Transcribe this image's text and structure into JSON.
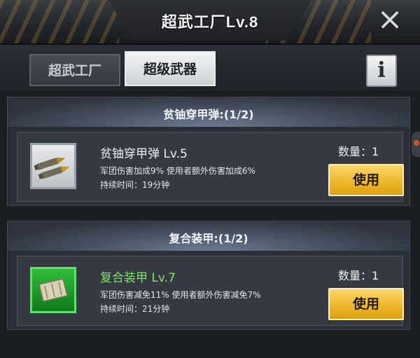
{
  "header": {
    "title": "超武工厂Lv.8",
    "close_icon": "×"
  },
  "tabs": [
    {
      "label": "超武工厂",
      "active": false
    },
    {
      "label": "超级武器",
      "active": true
    }
  ],
  "info_label": "i",
  "sections": [
    {
      "title": "贫铀穿甲弹:(1/2)",
      "item": {
        "name": "贫铀穿甲弹 Lv.5",
        "icon": "depleted-uranium-shells-icon",
        "desc1": "军团伤害加成9%   使用者额外伤害加成6%",
        "desc2": "持续时间：19分钟",
        "quantity": "数量：1",
        "button": "使用"
      }
    },
    {
      "title": "复合装甲:(1/2)",
      "item": {
        "name": "复合装甲 Lv.7",
        "icon": "composite-armor-icon",
        "desc1": "军团伤害减免11%   使用者额外伤害减免7%",
        "desc2": "持续时间：21分钟",
        "quantity": "数量：1",
        "button": "使用"
      }
    }
  ],
  "colors": {
    "accent_button": "#f0b92b",
    "armor_name": "#7ee36a",
    "armor_thumb": "#2fbe3a"
  }
}
